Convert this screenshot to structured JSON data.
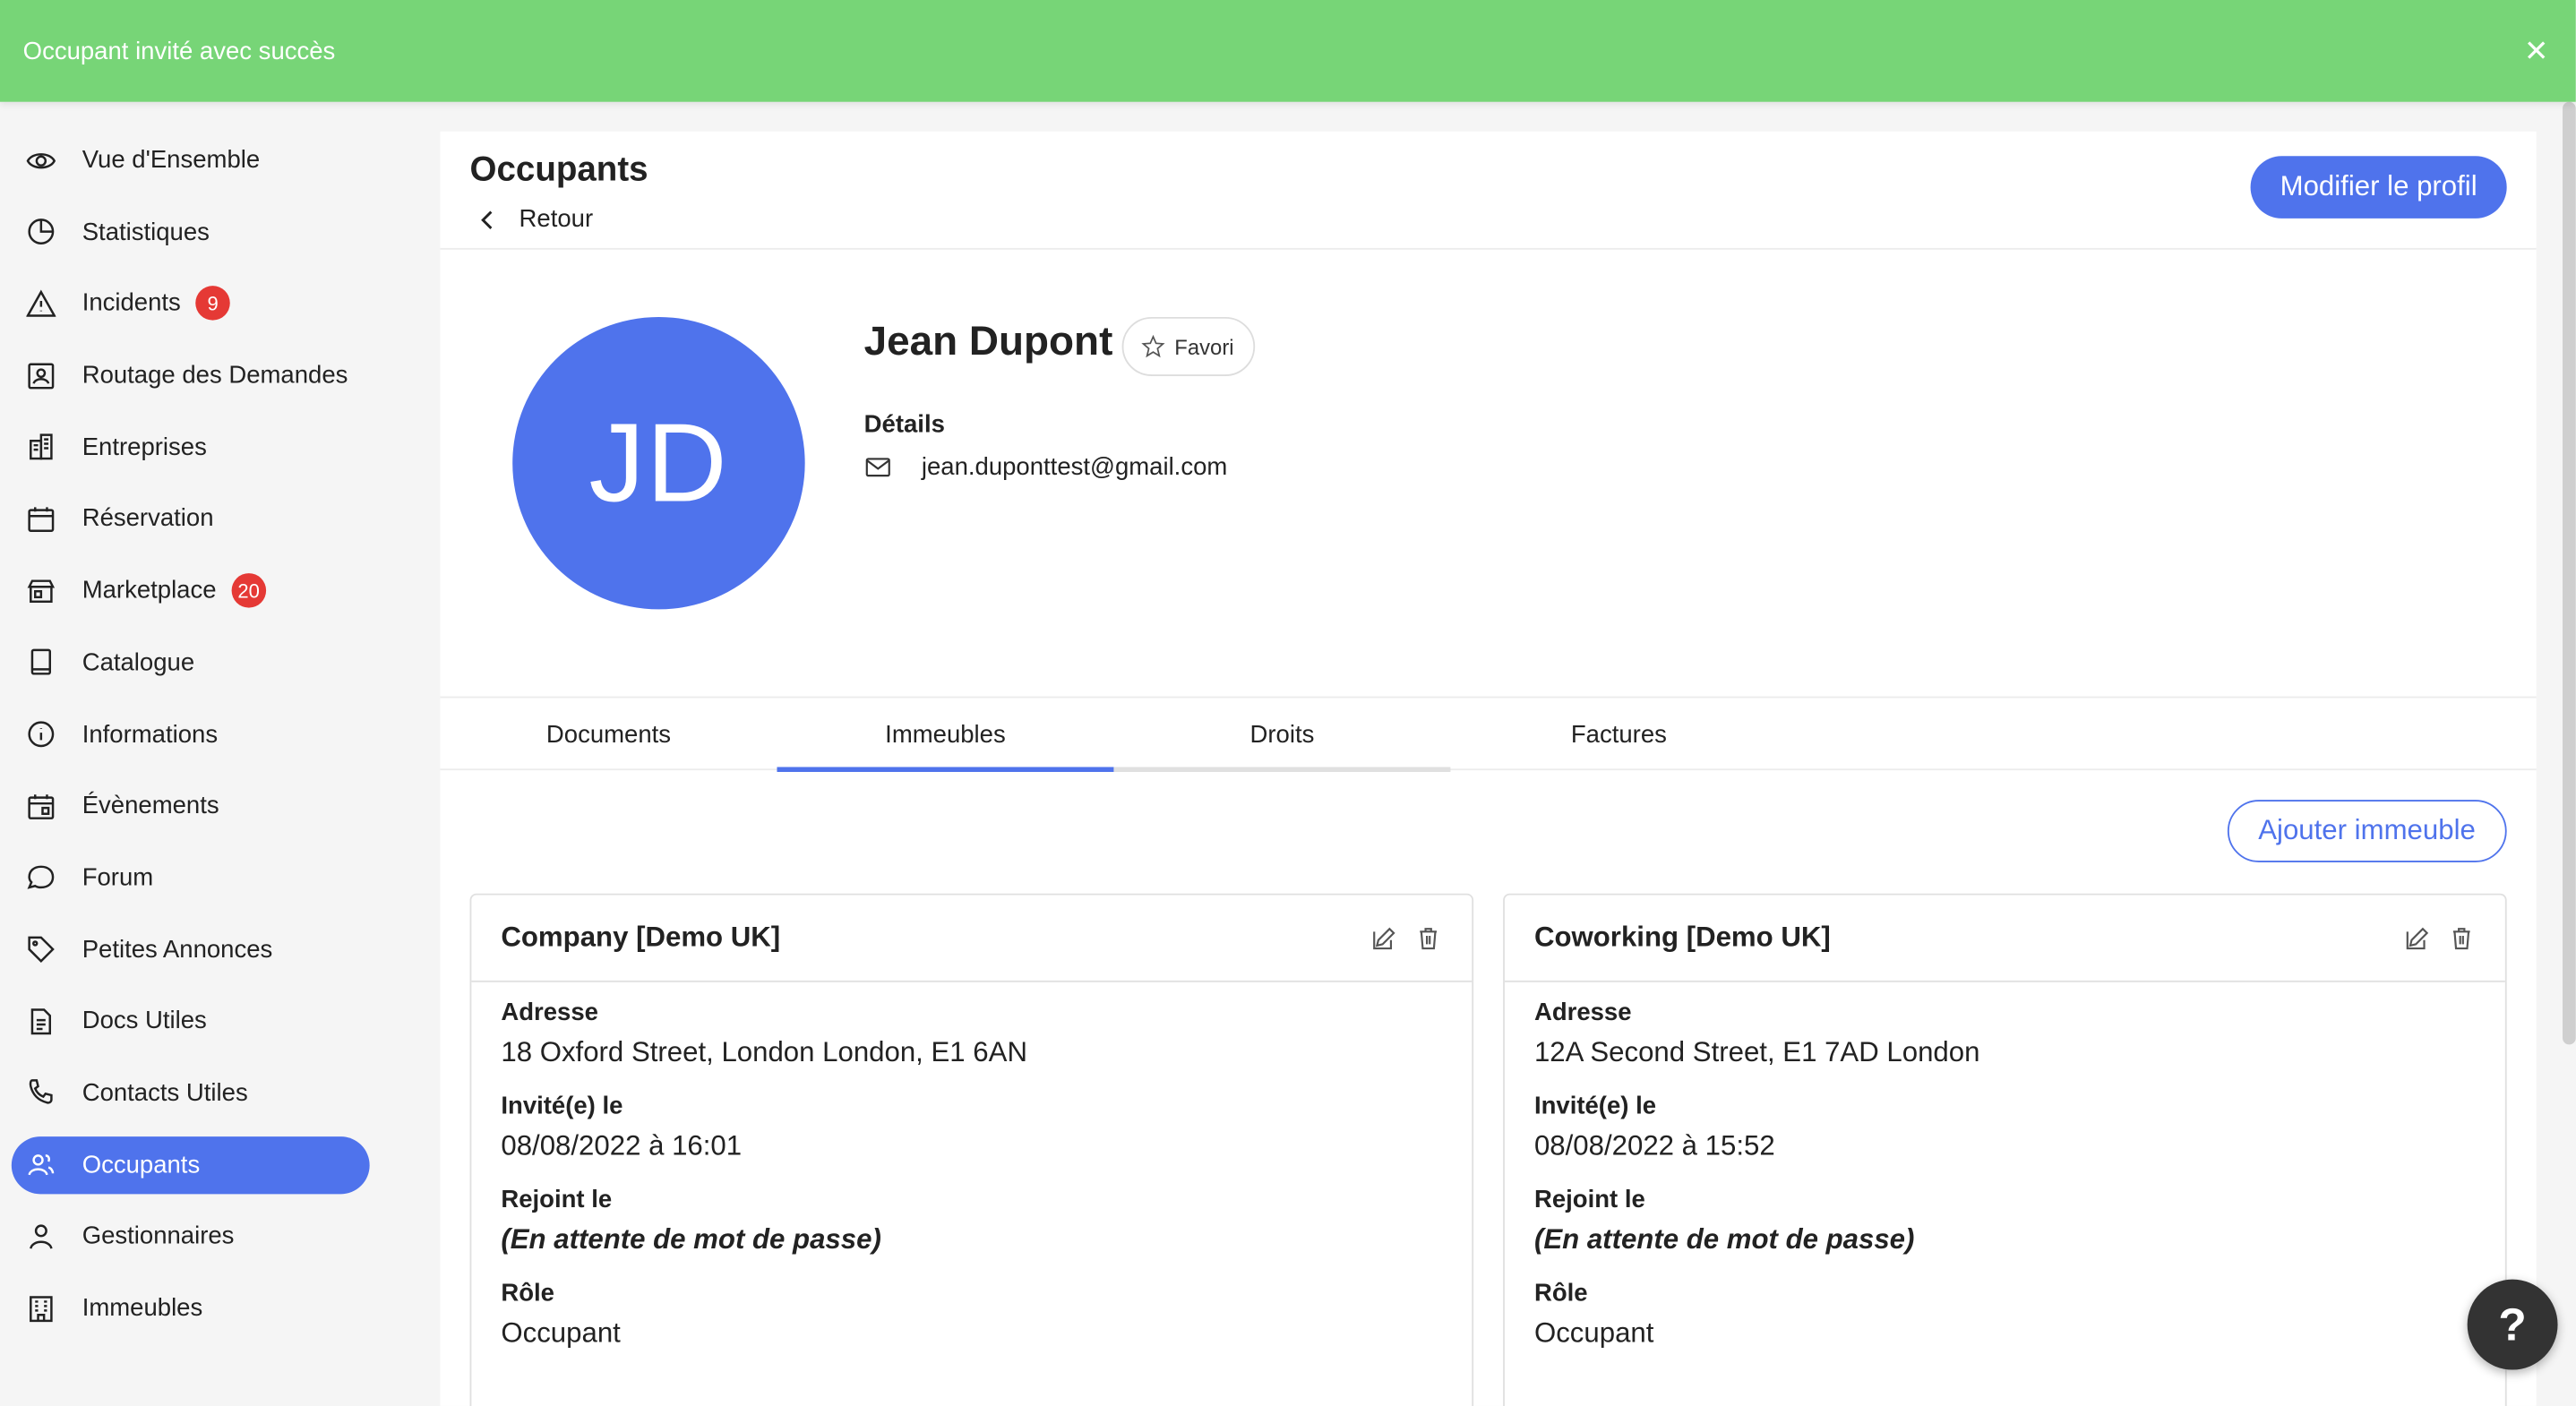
{
  "toast": {
    "message": "Occupant invité avec succès"
  },
  "sidebar": {
    "items": [
      {
        "label": "Vue d'Ensemble",
        "icon": "eye-icon"
      },
      {
        "label": "Statistiques",
        "icon": "pie-chart-icon"
      },
      {
        "label": "Incidents",
        "icon": "warning-icon",
        "badge": "9"
      },
      {
        "label": "Routage des Demandes",
        "icon": "contact-card-icon"
      },
      {
        "label": "Entreprises",
        "icon": "buildings-icon"
      },
      {
        "label": "Réservation",
        "icon": "calendar-icon"
      },
      {
        "label": "Marketplace",
        "icon": "store-icon",
        "badge": "20"
      },
      {
        "label": "Catalogue",
        "icon": "book-icon"
      },
      {
        "label": "Informations",
        "icon": "info-icon"
      },
      {
        "label": "Évènements",
        "icon": "calendar-event-icon"
      },
      {
        "label": "Forum",
        "icon": "chat-bubble-icon"
      },
      {
        "label": "Petites Annonces",
        "icon": "tag-icon"
      },
      {
        "label": "Docs Utiles",
        "icon": "document-icon"
      },
      {
        "label": "Contacts Utiles",
        "icon": "phone-icon"
      },
      {
        "label": "Occupants",
        "icon": "users-icon",
        "active": true
      },
      {
        "label": "Gestionnaires",
        "icon": "user-icon"
      },
      {
        "label": "Immeubles",
        "icon": "building-icon"
      }
    ]
  },
  "header": {
    "title": "Occupants",
    "back_label": "Retour",
    "edit_label": "Modifier le profil"
  },
  "profile": {
    "initials": "JD",
    "name": "Jean Dupont",
    "favorite_label": "Favori",
    "details_label": "Détails",
    "email": "jean.duponttest@gmail.com"
  },
  "tabs": [
    {
      "label": "Documents"
    },
    {
      "label": "Immeubles",
      "active": true
    },
    {
      "label": "Droits"
    },
    {
      "label": "Factures"
    }
  ],
  "add_building_label": "Ajouter immeuble",
  "cards": [
    {
      "title": "Company [Demo UK]",
      "address_label": "Adresse",
      "address": "18 Oxford Street, London London, E1 6AN",
      "invited_label": "Invité(e) le",
      "invited": "08/08/2022 à 16:01",
      "joined_label": "Rejoint le",
      "joined": "(En attente de mot de passe)",
      "role_label": "Rôle",
      "role": "Occupant"
    },
    {
      "title": "Coworking [Demo UK]",
      "address_label": "Adresse",
      "address": "12A Second Street, E1 7AD London",
      "invited_label": "Invité(e) le",
      "invited": "08/08/2022 à 15:52",
      "joined_label": "Rejoint le",
      "joined": "(En attente de mot de passe)",
      "role_label": "Rôle",
      "role": "Occupant"
    }
  ],
  "help_label": "?",
  "colors": {
    "accent": "#4f73ec",
    "toast": "#77d577",
    "badge": "#e53935"
  }
}
